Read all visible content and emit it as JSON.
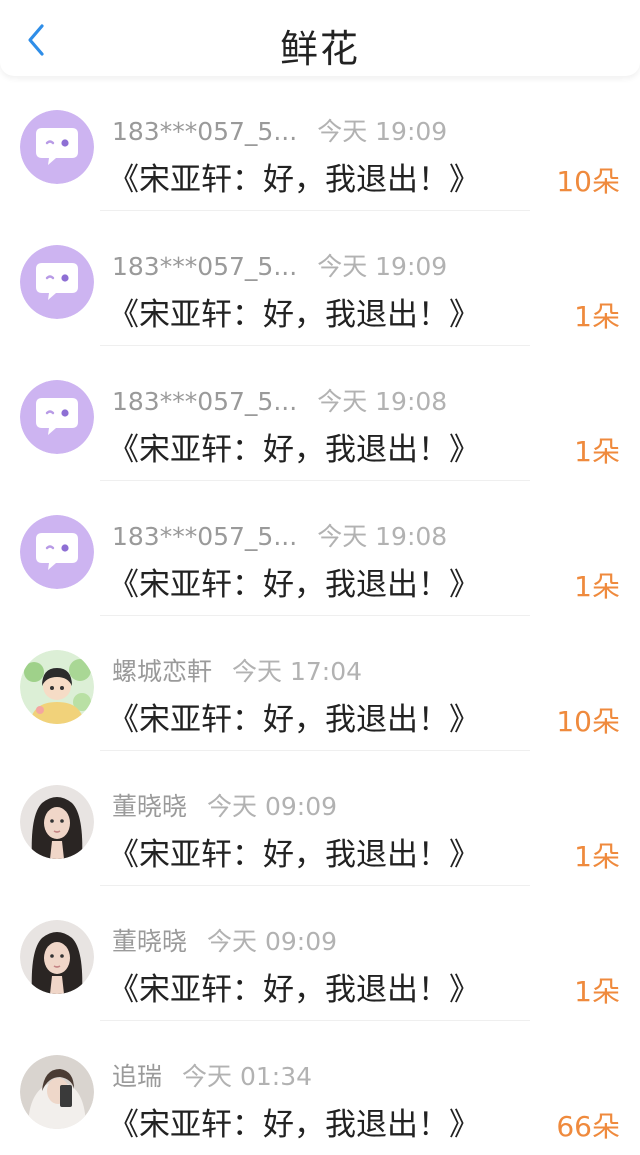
{
  "header": {
    "title": "鲜花",
    "back_icon": "chevron-left-icon"
  },
  "colors": {
    "accent_blue": "#2f8ee8",
    "count_orange": "#ef8a3d",
    "avatar_purple": "#cdb4f1"
  },
  "items": [
    {
      "name": "183***057_5...",
      "time": "今天 19:09",
      "message": "《宋亚轩：好，我退出！》",
      "count": "10朵",
      "avatar": "purple-chat-avatar"
    },
    {
      "name": "183***057_5...",
      "time": "今天 19:09",
      "message": "《宋亚轩：好，我退出！》",
      "count": "1朵",
      "avatar": "purple-chat-avatar"
    },
    {
      "name": "183***057_5...",
      "time": "今天 19:08",
      "message": "《宋亚轩：好，我退出！》",
      "count": "1朵",
      "avatar": "purple-chat-avatar"
    },
    {
      "name": "183***057_5...",
      "time": "今天 19:08",
      "message": "《宋亚轩：好，我退出！》",
      "count": "1朵",
      "avatar": "purple-chat-avatar"
    },
    {
      "name": "螺城恋軒",
      "time": "今天 17:04",
      "message": "《宋亚轩：好，我退出！》",
      "count": "10朵",
      "avatar": "cartoon-boy-avatar"
    },
    {
      "name": "董晓晓",
      "time": "今天 09:09",
      "message": "《宋亚轩：好，我退出！》",
      "count": "1朵",
      "avatar": "girl-photo-avatar"
    },
    {
      "name": "董晓晓",
      "time": "今天 09:09",
      "message": "《宋亚轩：好，我退出！》",
      "count": "1朵",
      "avatar": "girl-photo-avatar"
    },
    {
      "name": "追瑞",
      "time": "今天 01:34",
      "message": "《宋亚轩：好，我退出！》",
      "count": "66朵",
      "avatar": "selfie-photo-avatar"
    }
  ]
}
